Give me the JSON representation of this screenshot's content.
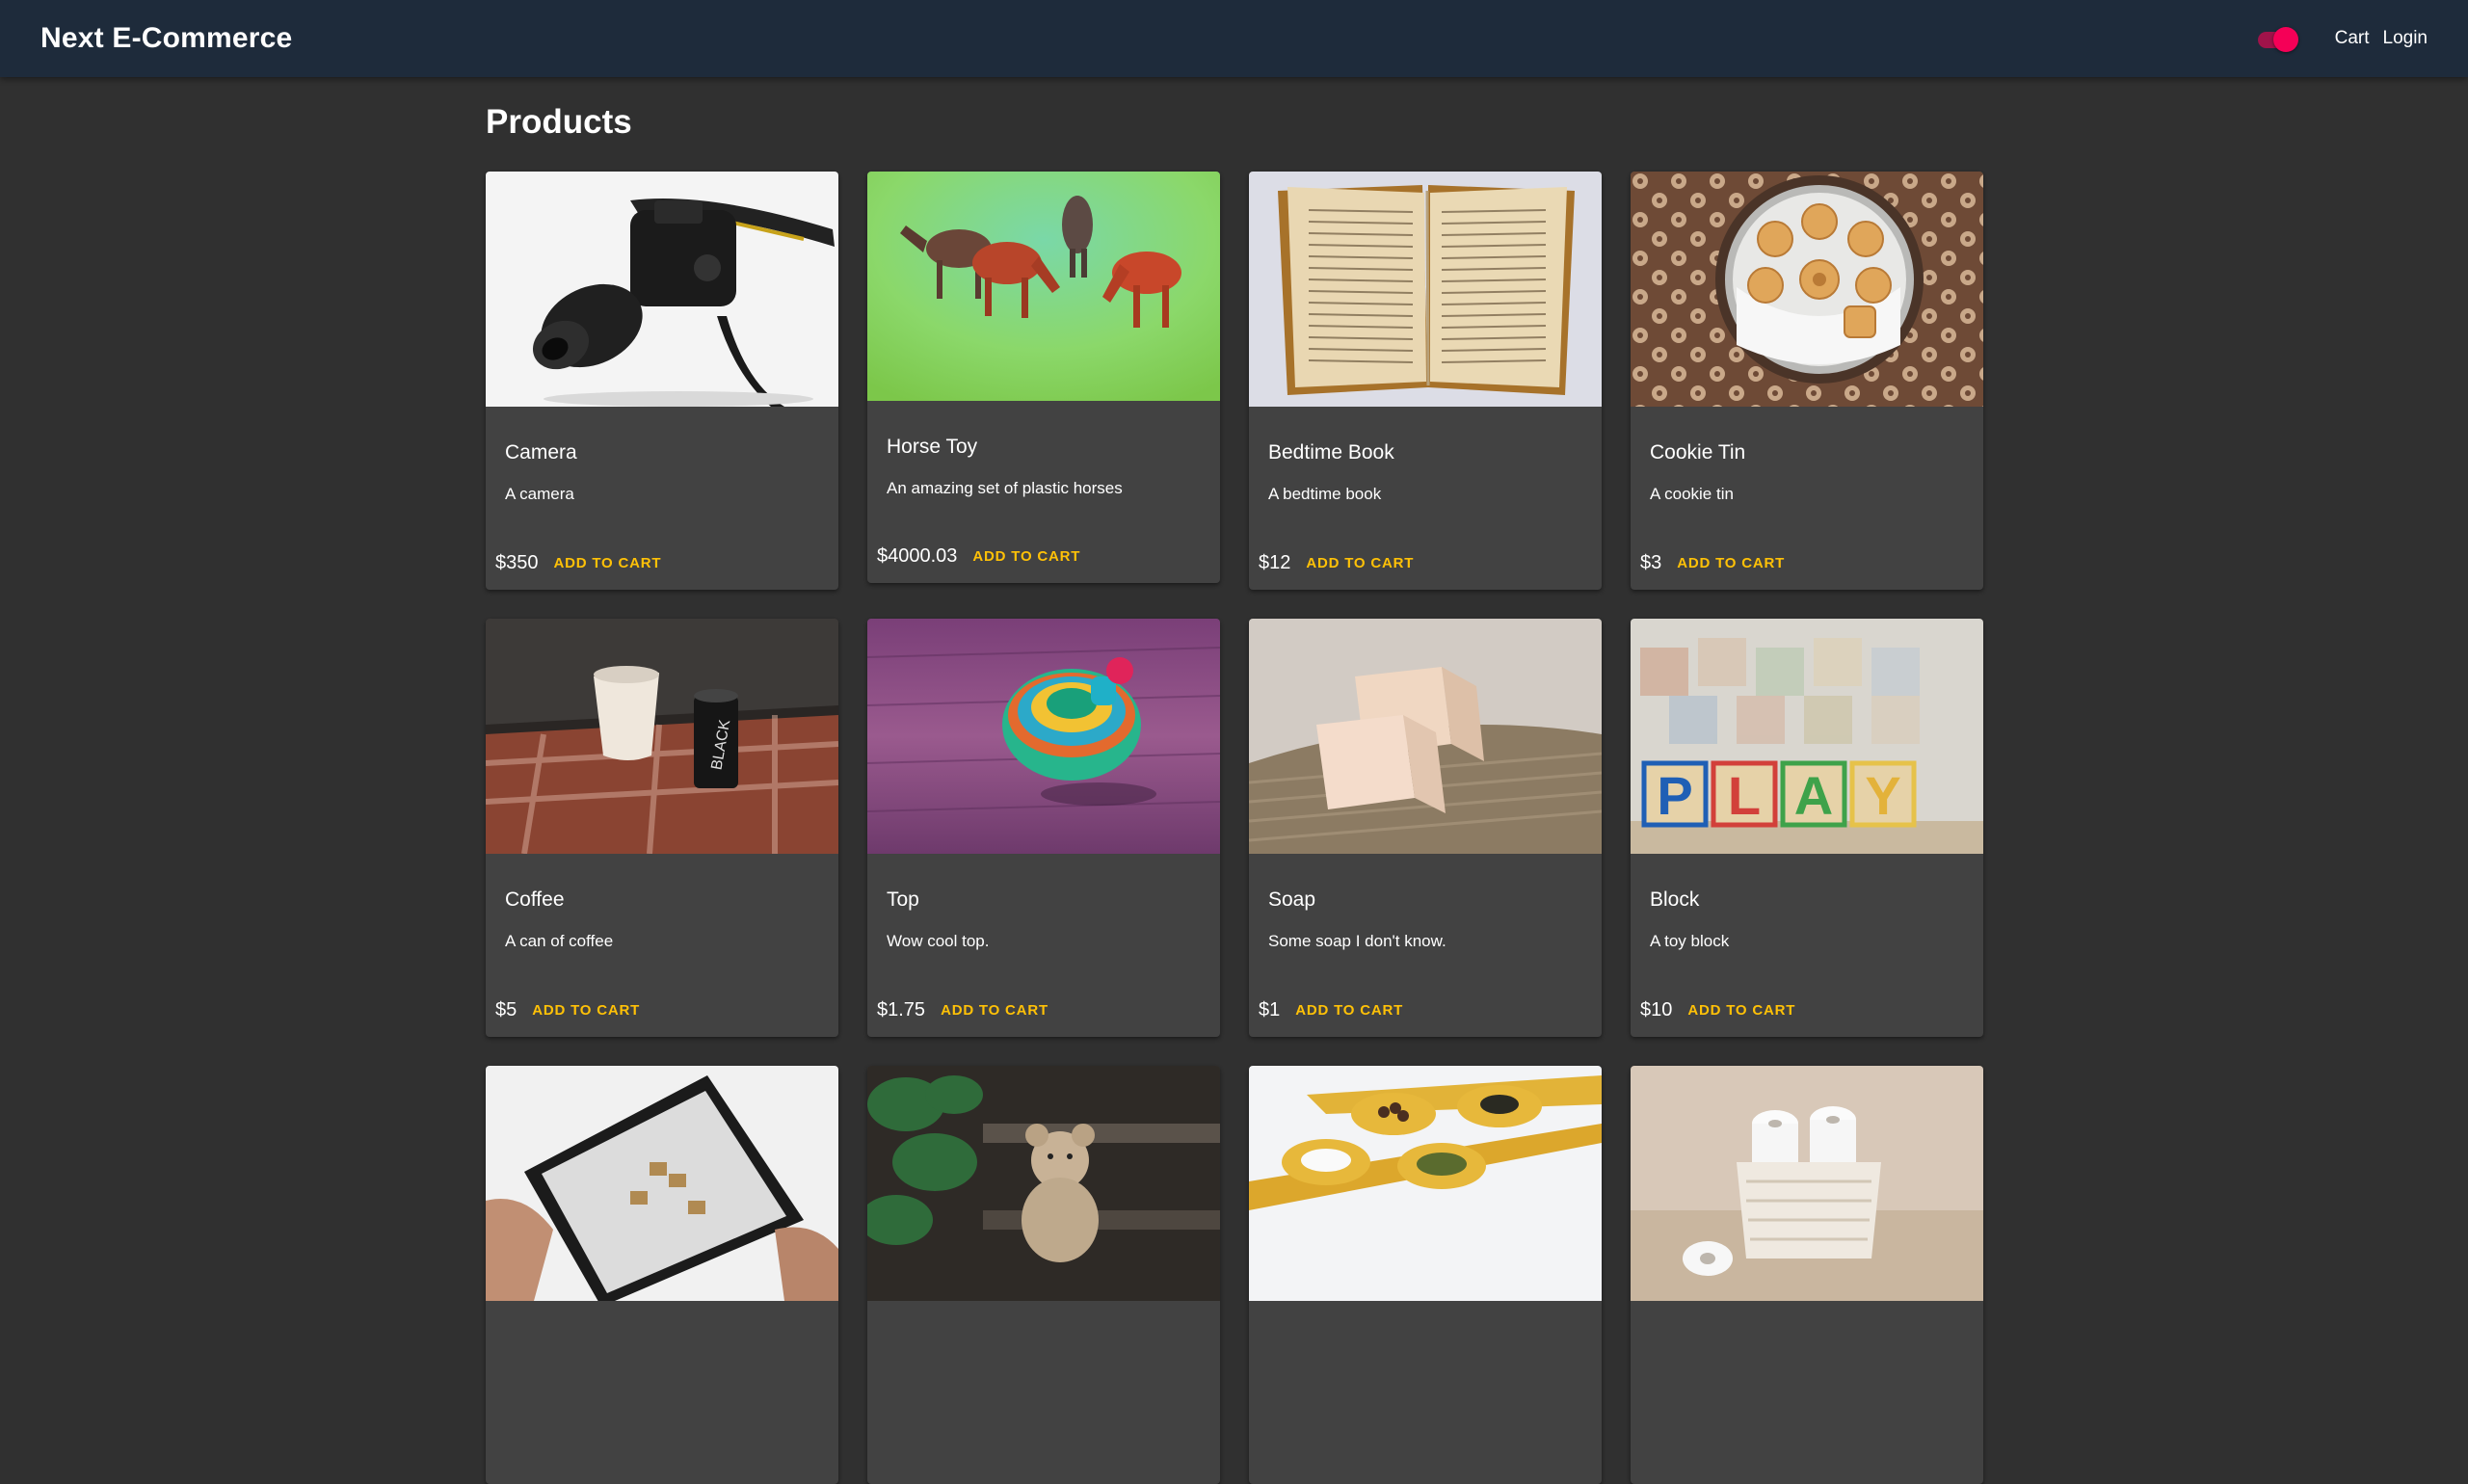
{
  "appbar": {
    "title": "Next E-Commerce",
    "cart_label": "Cart",
    "login_label": "Login",
    "theme_toggle_on": true
  },
  "page": {
    "title": "Products"
  },
  "colors": {
    "accent": "#ffc107",
    "toggle": "#f50057",
    "appbar": "#1e2b3b",
    "card": "#424242"
  },
  "products": [
    {
      "name": "Camera",
      "description": "A camera",
      "price": "$350",
      "action": "ADD TO CART",
      "image": "camera"
    },
    {
      "name": "Horse Toy",
      "description": "An amazing set of plastic horses",
      "price": "$4000.03",
      "action": "ADD TO CART",
      "image": "horses"
    },
    {
      "name": "Bedtime Book",
      "description": "A bedtime book",
      "price": "$12",
      "action": "ADD TO CART",
      "image": "book"
    },
    {
      "name": "Cookie Tin",
      "description": "A cookie tin",
      "price": "$3",
      "action": "ADD TO CART",
      "image": "cookies"
    },
    {
      "name": "Coffee",
      "description": "A can of coffee",
      "price": "$5",
      "action": "ADD TO CART",
      "image": "coffee"
    },
    {
      "name": "Top",
      "description": "Wow cool top.",
      "price": "$1.75",
      "action": "ADD TO CART",
      "image": "spinning-top"
    },
    {
      "name": "Soap",
      "description": "Some soap I don't know.",
      "price": "$1",
      "action": "ADD TO CART",
      "image": "soap"
    },
    {
      "name": "Block",
      "description": "A toy block",
      "price": "$10",
      "action": "ADD TO CART",
      "image": "play-blocks"
    },
    {
      "image": "tablet"
    },
    {
      "image": "teddy-bear"
    },
    {
      "image": "spice-spoons"
    },
    {
      "image": "toilet-paper"
    }
  ]
}
